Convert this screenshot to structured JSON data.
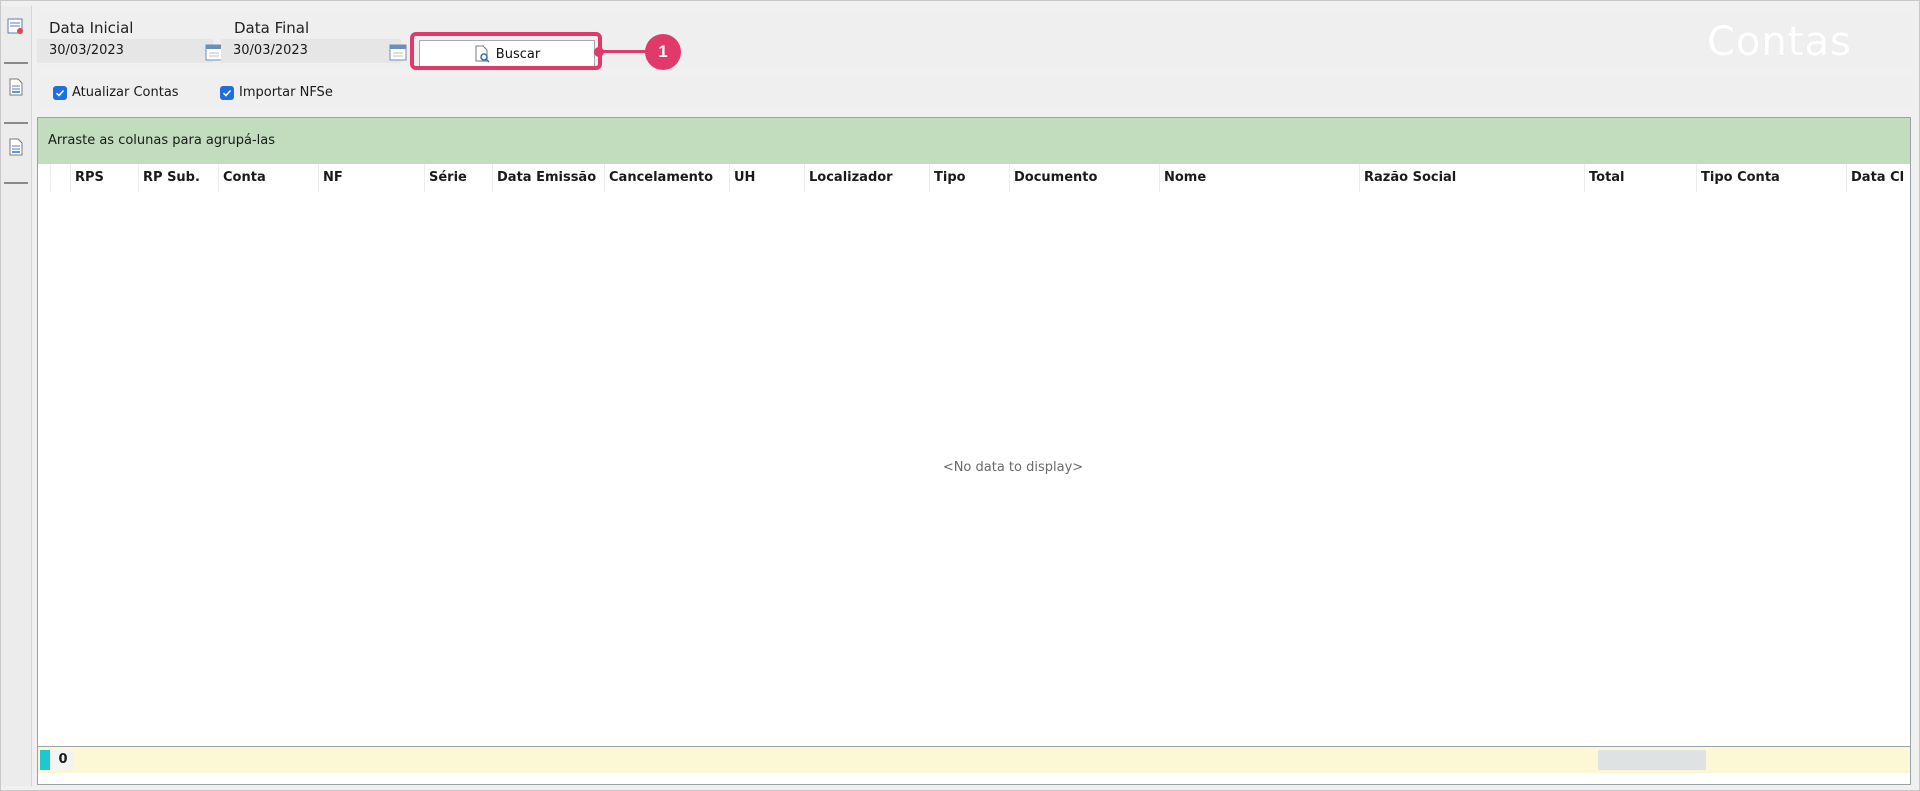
{
  "filters": {
    "start_label": "Data Inicial",
    "start_value": "30/03/2023",
    "end_label": "Data Final",
    "end_value": "30/03/2023",
    "search_label": "Buscar"
  },
  "watermark": "Contas",
  "callout": "1",
  "options": {
    "update_accounts_label": "Atualizar Contas",
    "import_nfse_label": "Importar NFSe"
  },
  "grid": {
    "group_hint": "Arraste as colunas para agrupá-las",
    "columns": [
      "RPS",
      "RP Sub.",
      "Conta",
      "NF",
      "Série",
      "Data Emissão",
      "Cancelamento",
      "UH",
      "Localizador",
      "Tipo",
      "Documento",
      "Nome",
      "Razão Social",
      "Total",
      "Tipo Conta",
      "Data Cl"
    ],
    "empty_text": "<No data to display>",
    "footer_count": "0"
  },
  "colors": {
    "highlight": "#e0396a",
    "group_panel": "#c1ddbe",
    "footer": "#fcf8d6",
    "checkbox": "#1e6fd9"
  }
}
